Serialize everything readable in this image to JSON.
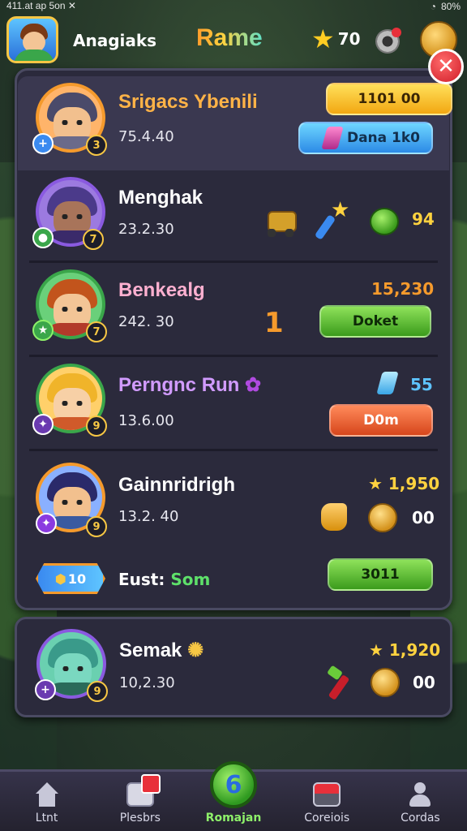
{
  "status_bar": {
    "left_text": "411.at ap 5on ✕",
    "battery": "80%"
  },
  "header": {
    "player_name": "Anagiaks",
    "title": "Rame",
    "stars": "70"
  },
  "rows": [
    {
      "name": "Srigacs Ybenili",
      "score": "75.4.40",
      "action_top": "1101 00",
      "action_bottom": "Dana 1k0",
      "name_color": "#ffb347"
    },
    {
      "name": "Menghak",
      "score": "23.2.30",
      "value": "94",
      "name_color": "#ffffff"
    },
    {
      "name": "Benkealg",
      "score": "242. 30",
      "value": "15,230",
      "mid": "1",
      "action": "Doket",
      "name_color": "#ffb0d0"
    },
    {
      "name": "Perngnc Run",
      "score": "13.6.00",
      "value": "55",
      "action": "D0m",
      "name_color": "#d19bff"
    },
    {
      "name": "Gainnridrigh",
      "score": "13.2. 40",
      "value": "★ 1,950",
      "value2": "00",
      "name_color": "#ffffff"
    }
  ],
  "event": {
    "badge": "10",
    "label_1": "Eust:",
    "label_2": "Som",
    "action": "3011"
  },
  "card2": {
    "name": "Semak",
    "score": "10,2.30",
    "value": "★ 1,920",
    "value2": "00"
  },
  "nav": [
    {
      "label": "Ltnt"
    },
    {
      "label": "Plesbrs"
    },
    {
      "label": "Romajan",
      "badge": "6"
    },
    {
      "label": "Coreiois"
    },
    {
      "label": "Cordas"
    }
  ],
  "colors": {
    "panel": "#2b2a3c",
    "accent_orange": "#f59a2c",
    "accent_green": "#5ee06a"
  }
}
